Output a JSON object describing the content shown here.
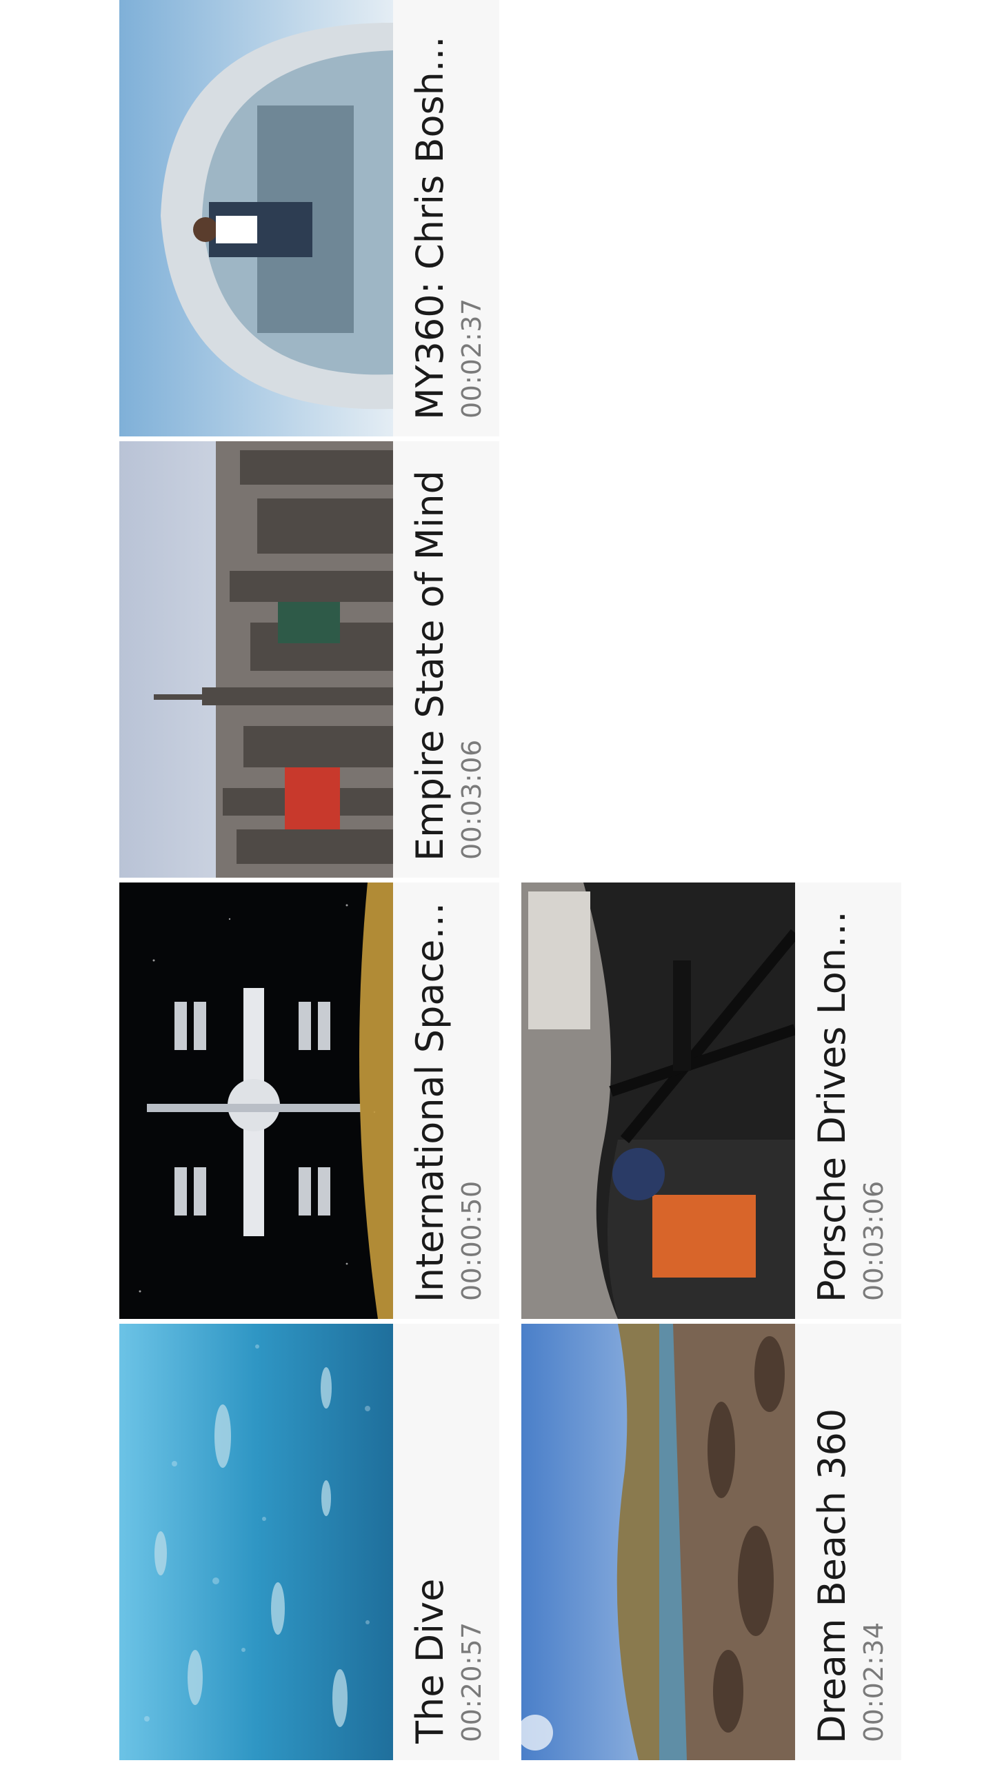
{
  "videos": [
    {
      "title": "The Dive",
      "duration": "00:20:57",
      "thumbnail": "underwater-fish-icon",
      "accent": "#2f8fb8"
    },
    {
      "title": "International Space St...",
      "duration": "00:00:50",
      "thumbnail": "space-station-icon",
      "accent": "#050608"
    },
    {
      "title": "Empire State of Mind",
      "duration": "00:03:06",
      "thumbnail": "city-skyline-icon",
      "accent": "#8a8f98"
    },
    {
      "title": "MY360: Chris Bosh...",
      "duration": "00:02:37",
      "thumbnail": "balcony-person-icon",
      "accent": "#9fb6c8"
    },
    {
      "title": "Dream Beach 360",
      "duration": "00:02:34",
      "thumbnail": "rocky-beach-icon",
      "accent": "#7a6452"
    },
    {
      "title": "Porsche Drives Long...",
      "duration": "00:03:06",
      "thumbnail": "race-car-cockpit-icon",
      "accent": "#202020"
    }
  ]
}
